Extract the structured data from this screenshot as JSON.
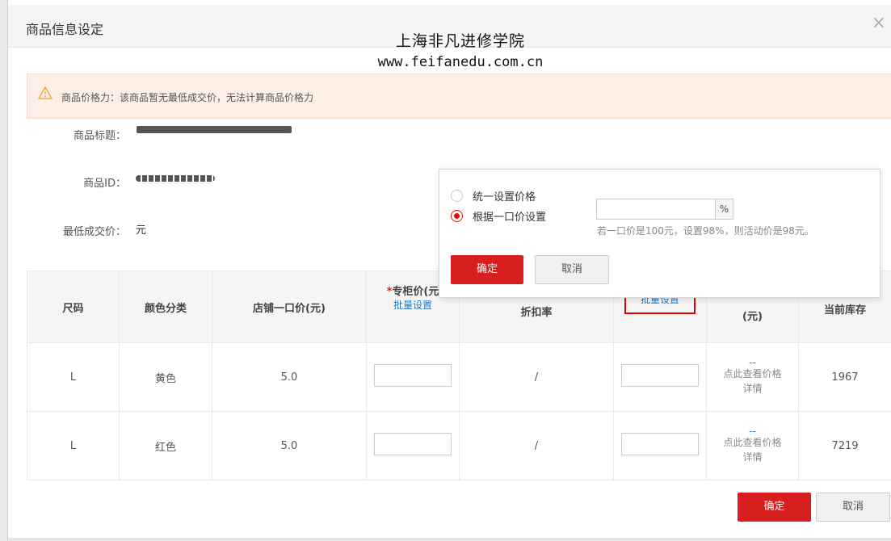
{
  "dialog": {
    "title": "商品信息设定",
    "close_glyph": "×"
  },
  "watermark": {
    "line1": "上海非凡进修学院",
    "line2": "www.feifanedu.com.cn"
  },
  "alert": {
    "icon": "warning-icon",
    "text": "商品价格力：该商品暂无最低成交价，无法计算商品价格力"
  },
  "fields": {
    "title_label": "商品标题：",
    "id_label": "商品ID：",
    "min_price_label": "最低成交价：",
    "min_price_value": "元"
  },
  "table": {
    "headers": {
      "size": "尺码",
      "color": "颜色分类",
      "shop_price": "店铺一口价(元)",
      "counter_price_mark": "*",
      "counter_price": "专柜价(元",
      "counter_batch": "批量设置",
      "discount": "折扣率",
      "batch_highlight": "批量设置",
      "price_unit": "(元)",
      "stock": "当前库存"
    },
    "rows": [
      {
        "size": "L",
        "color": "黄色",
        "price": "5.0",
        "discount": "/",
        "detail_link": "--",
        "detail_line1": "点此查看价格",
        "detail_line2": "详情",
        "stock": "1967"
      },
      {
        "size": "L",
        "color": "红色",
        "price": "5.0",
        "discount": "/",
        "detail_link": "--",
        "detail_line1": "点此查看价格",
        "detail_line2": "详情",
        "stock": "7219"
      }
    ]
  },
  "popup": {
    "option1": "统一设置价格",
    "option2": "根据一口价设置",
    "selected_option": "option2",
    "percent_value": "",
    "percent_unit": "%",
    "hint": "若一口价是100元，设置98%，则活动价是98元。",
    "confirm": "确定",
    "cancel": "取消"
  },
  "footer": {
    "confirm": "确定",
    "cancel": "取消"
  },
  "colors": {
    "primary_red": "#d71f1f",
    "link_blue": "#1a7ad0",
    "alert_bg": "#fdeee6",
    "highlight_border": "#e00000"
  }
}
